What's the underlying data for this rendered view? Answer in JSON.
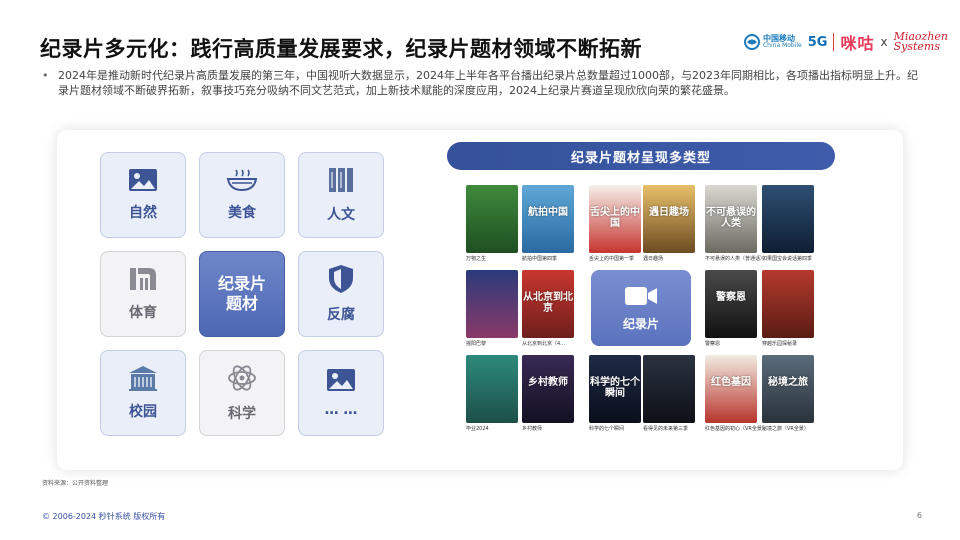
{
  "title": "纪录片多元化：践行高质量发展要求，纪录片题材领域不断拓新",
  "logos": {
    "china_mobile_cn": "中国移动",
    "china_mobile_en": "China Mobile",
    "five_g": "5G",
    "migu": "咪咕",
    "x": "x",
    "miaozhen_1": "Miaozhen",
    "miaozhen_2": "Systems"
  },
  "bullet": "2024年是推动新时代纪录片高质量发展的第三年，中国视听大数据显示，2024年上半年各平台播出纪录片总数量超过1000部，与2023年同期相比，各项播出指标明显上升。纪录片题材领域不断破界拓新，叙事技巧充分吸纳不同文艺范式，加上新技术赋能的深度应用，2024上纪录片赛道呈现欣欣向荣的繁花盛景。",
  "categories": {
    "nature": "自然",
    "food": "美食",
    "culture": "人文",
    "sports": "体育",
    "center": "纪录片\n题材",
    "anticorruption": "反腐",
    "campus": "校园",
    "science": "科学",
    "more": "… …"
  },
  "banner": "纪录片题材呈现多类型",
  "doc_label": "纪录片",
  "posters": [
    {
      "caption": "万物之生",
      "text": ""
    },
    {
      "caption": "航拍中国第四季",
      "text": "航拍中国"
    },
    {
      "caption": "舌尖上的中国第一季",
      "text": "舌尖上的中国"
    },
    {
      "caption": "遇日趣场",
      "text": "遇日趣场"
    },
    {
      "caption": "不可悬误的人类（普通话）",
      "text": "不可悬误的人类"
    },
    {
      "caption": "如果国宝会说话第四季",
      "text": ""
    },
    {
      "caption": "摇阳巴黎",
      "text": ""
    },
    {
      "caption": "从北京到北京（4…",
      "text": "从北京到北京"
    },
    {
      "caption": "警察恩",
      "text": "警察恩"
    },
    {
      "caption": "穿越乐园探秘录",
      "text": ""
    },
    {
      "caption": "毕业2024",
      "text": ""
    },
    {
      "caption": "乡村教师",
      "text": "乡村教师"
    },
    {
      "caption": "科学的七个瞬间",
      "text": "科学的七个瞬间"
    },
    {
      "caption": "看得见的未来第三季",
      "text": ""
    },
    {
      "caption": "红色基因的初心（VR全景）",
      "text": "红色基因"
    },
    {
      "caption": "秘境之旅（VR全景）",
      "text": "秘境之旅"
    }
  ],
  "source": "资料来源：公开资料整理",
  "footer": "© 2006-2024 秒针系统 版权所有",
  "page_number": "6"
}
